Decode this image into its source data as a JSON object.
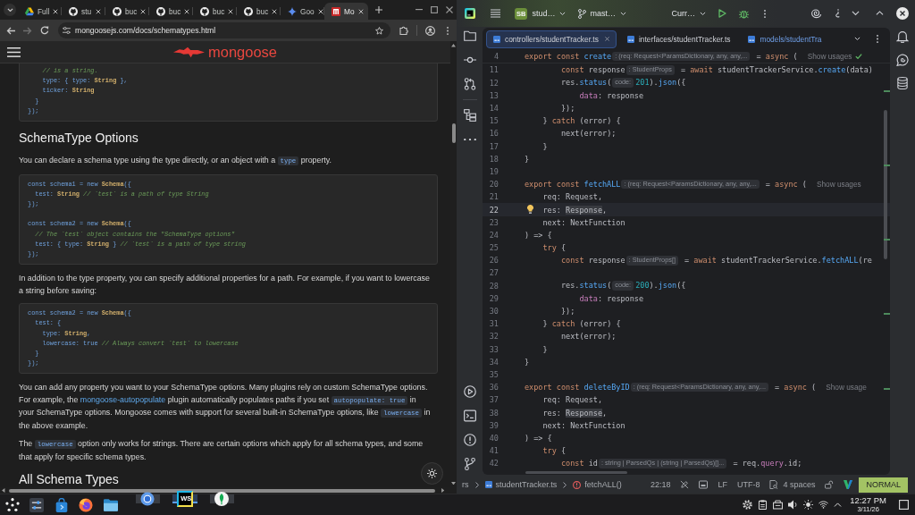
{
  "browser": {
    "tabs": [
      {
        "kind": "drive",
        "title": "Full",
        "selected": false
      },
      {
        "kind": "repo",
        "title": "stu",
        "selected": false
      },
      {
        "kind": "repo",
        "title": "buc",
        "selected": false
      },
      {
        "kind": "repo",
        "title": "buc",
        "selected": false
      },
      {
        "kind": "repo",
        "title": "buc",
        "selected": false
      },
      {
        "kind": "repo",
        "title": "buc",
        "selected": false
      },
      {
        "kind": "assistant",
        "title": "Goo",
        "selected": false
      },
      {
        "kind": "docs",
        "title": "Mo",
        "selected": true
      }
    ],
    "url": "mongoosejs.com/docs/schematypes.html",
    "site": {
      "logo_text": "mongoose"
    },
    "content": [
      {
        "kind": "code",
        "sections": [
          [
            [
              {
                "kind": "comment",
                "text": "    // is a string."
              }
            ],
            [
              {
                "kind": "plain",
                "text": "    type: { type: "
              },
              {
                "kind": "type",
                "text": "String"
              },
              {
                "kind": "plain",
                "text": " },"
              }
            ],
            [
              {
                "kind": "plain",
                "text": "    ticker: "
              },
              {
                "kind": "type",
                "text": "String"
              }
            ],
            [
              {
                "kind": "plain",
                "text": "  }"
              }
            ],
            [
              {
                "kind": "plain",
                "text": "});"
              }
            ]
          ]
        ]
      },
      {
        "kind": "heading",
        "text": "SchemaType Options"
      },
      {
        "kind": "paragraph",
        "parts": [
          {
            "kind": "text",
            "text": "You can declare a schema type using the type directly, or an object with a "
          },
          {
            "kind": "code",
            "text": "type"
          },
          {
            "kind": "text",
            "text": " property."
          }
        ]
      },
      {
        "kind": "code",
        "sections": [
          [
            [
              {
                "kind": "plain",
                "text": "const schema1 = new "
              },
              {
                "kind": "type",
                "text": "Schema"
              },
              {
                "kind": "plain",
                "text": "({"
              }
            ],
            [
              {
                "kind": "plain",
                "text": "  test: "
              },
              {
                "kind": "type",
                "text": "String"
              },
              {
                "kind": "comment",
                "text": " // `test` is a path of type String"
              }
            ],
            [
              {
                "kind": "plain",
                "text": "});"
              }
            ]
          ],
          [
            [
              {
                "kind": "plain",
                "text": "const schema2 = new "
              },
              {
                "kind": "type",
                "text": "Schema"
              },
              {
                "kind": "plain",
                "text": "({"
              }
            ],
            [
              {
                "kind": "comment",
                "text": "  // The `test` object contains the \"SchemaType options\""
              }
            ],
            [
              {
                "kind": "plain",
                "text": "  test: { type: "
              },
              {
                "kind": "type",
                "text": "String"
              },
              {
                "kind": "plain",
                "text": " } "
              },
              {
                "kind": "comment",
                "text": "// `test` is a path of type string"
              }
            ],
            [
              {
                "kind": "plain",
                "text": "});"
              }
            ]
          ]
        ]
      },
      {
        "kind": "paragraph",
        "parts": [
          {
            "kind": "text",
            "text": "In addition to the type property, you can specify additional properties for a path. For example, if you want to lowercase a string before saving:"
          }
        ]
      },
      {
        "kind": "code",
        "sections": [
          [
            [
              {
                "kind": "plain",
                "text": "const schema2 = new "
              },
              {
                "kind": "type",
                "text": "Schema"
              },
              {
                "kind": "plain",
                "text": "({"
              }
            ],
            [
              {
                "kind": "plain",
                "text": "  test: {"
              }
            ],
            [
              {
                "kind": "plain",
                "text": "    type: "
              },
              {
                "kind": "type",
                "text": "String"
              },
              {
                "kind": "plain",
                "text": ","
              }
            ],
            [
              {
                "kind": "plain",
                "text": "    lowercase: true "
              },
              {
                "kind": "comment",
                "text": "// Always convert `test` to lowercase"
              }
            ],
            [
              {
                "kind": "plain",
                "text": "  }"
              }
            ],
            [
              {
                "kind": "plain",
                "text": "});"
              }
            ]
          ]
        ]
      },
      {
        "kind": "paragraph",
        "parts": [
          {
            "kind": "text",
            "text": "You can add any property you want to your SchemaType options. Many plugins rely on custom SchemaType options. For example, the "
          },
          {
            "kind": "link",
            "text": "mongoose-autopopulate"
          },
          {
            "kind": "text",
            "text": " plugin automatically populates paths if you set "
          },
          {
            "kind": "code",
            "text": "autopopulate: true"
          },
          {
            "kind": "text",
            "text": " in your SchemaType options. Mongoose comes with support for several built-in SchemaType options, like "
          },
          {
            "kind": "code",
            "text": "lowercase"
          },
          {
            "kind": "text",
            "text": " in the above example."
          }
        ]
      },
      {
        "kind": "paragraph",
        "parts": [
          {
            "kind": "text",
            "text": "The "
          },
          {
            "kind": "code",
            "text": "lowercase"
          },
          {
            "kind": "text",
            "text": " option only works for strings. There are certain options which apply for all schema types, and some that apply for specific schema types."
          }
        ]
      },
      {
        "kind": "heading",
        "text": "All Schema Types"
      }
    ]
  },
  "ide": {
    "project": {
      "badge": "SB",
      "name": "stud…"
    },
    "branch": "mast…",
    "run_config": "Curr…",
    "tabs": [
      {
        "title": "controllers/studentTracker.ts",
        "selected": true,
        "modified": false
      },
      {
        "title": "interfaces/studentTracker.ts",
        "selected": false,
        "modified": false
      },
      {
        "title": "models/studentTra",
        "selected": false,
        "modified": true
      }
    ],
    "sticky_line": {
      "number": "4",
      "tokens": [
        {
          "kind": "keyword",
          "text": "export const "
        },
        {
          "kind": "function",
          "text": "create"
        },
        {
          "kind": "hint",
          "text": ": (req: Request<ParamsDictionary, any, any,..."
        },
        {
          "kind": "plain",
          "text": " = "
        },
        {
          "kind": "keyword",
          "text": "async"
        },
        {
          "kind": "plain",
          "text": " ("
        },
        {
          "kind": "usage",
          "text": "Show usages"
        },
        {
          "kind": "check"
        }
      ]
    },
    "lines": [
      {
        "number": "11",
        "current": false,
        "bulb": false,
        "tokens": [
          {
            "kind": "keyword",
            "text": "        const"
          },
          {
            "kind": "plain",
            "text": " response"
          },
          {
            "kind": "hint",
            "text": ": StudentProps"
          },
          {
            "kind": "plain",
            "text": " = "
          },
          {
            "kind": "keyword",
            "text": "await"
          },
          {
            "kind": "plain",
            "text": " studentTrackerService."
          },
          {
            "kind": "function",
            "text": "create"
          },
          {
            "kind": "plain",
            "text": "(data)"
          }
        ]
      },
      {
        "number": "12",
        "current": false,
        "bulb": false,
        "tokens": [
          {
            "kind": "plain",
            "text": "        res."
          },
          {
            "kind": "function",
            "text": "status"
          },
          {
            "kind": "plain",
            "text": "("
          },
          {
            "kind": "hint",
            "text": "code:"
          },
          {
            "kind": "number",
            "text": "201"
          },
          {
            "kind": "plain",
            "text": ")."
          },
          {
            "kind": "function",
            "text": "json"
          },
          {
            "kind": "plain",
            "text": "({"
          }
        ]
      },
      {
        "number": "13",
        "current": false,
        "bulb": false,
        "tokens": [
          {
            "kind": "property",
            "text": "            data"
          },
          {
            "kind": "plain",
            "text": ": response"
          }
        ]
      },
      {
        "number": "14",
        "current": false,
        "bulb": false,
        "tokens": [
          {
            "kind": "plain",
            "text": "        });"
          }
        ]
      },
      {
        "number": "15",
        "current": false,
        "bulb": false,
        "tokens": [
          {
            "kind": "plain",
            "text": "    } "
          },
          {
            "kind": "keyword",
            "text": "catch"
          },
          {
            "kind": "plain",
            "text": " (error) {"
          }
        ]
      },
      {
        "number": "16",
        "current": false,
        "bulb": false,
        "tokens": [
          {
            "kind": "plain",
            "text": "        next(error);"
          }
        ]
      },
      {
        "number": "17",
        "current": false,
        "bulb": false,
        "tokens": [
          {
            "kind": "plain",
            "text": "    }"
          }
        ]
      },
      {
        "number": "18",
        "current": false,
        "bulb": false,
        "tokens": [
          {
            "kind": "plain",
            "text": "}"
          }
        ]
      },
      {
        "number": "19",
        "current": false,
        "bulb": false
      },
      {
        "number": "20",
        "current": false,
        "bulb": false,
        "tokens": [
          {
            "kind": "keyword",
            "text": "export const "
          },
          {
            "kind": "function",
            "text": "fetchALL"
          },
          {
            "kind": "hint",
            "text": ": (req: Request<ParamsDictionary, any, any,..."
          },
          {
            "kind": "plain",
            "text": " = "
          },
          {
            "kind": "keyword",
            "text": "async"
          },
          {
            "kind": "plain",
            "text": " ("
          },
          {
            "kind": "usage",
            "text": "Show usages"
          }
        ]
      },
      {
        "number": "21",
        "current": false,
        "bulb": false,
        "tokens": [
          {
            "kind": "plain",
            "text": "    req: Request,"
          }
        ]
      },
      {
        "number": "22",
        "current": true,
        "bulb": true,
        "tokens": [
          {
            "kind": "plain",
            "text": "    res: "
          },
          {
            "kind": "highlight",
            "text": "Response"
          },
          {
            "kind": "plain",
            "text": ","
          }
        ]
      },
      {
        "number": "23",
        "current": false,
        "bulb": false,
        "tokens": [
          {
            "kind": "plain",
            "text": "    next: NextFunction"
          }
        ]
      },
      {
        "number": "24",
        "current": false,
        "bulb": false,
        "tokens": [
          {
            "kind": "plain",
            "text": ") => {"
          }
        ]
      },
      {
        "number": "25",
        "current": false,
        "bulb": false,
        "tokens": [
          {
            "kind": "keyword",
            "text": "    try"
          },
          {
            "kind": "plain",
            "text": " {"
          }
        ]
      },
      {
        "number": "26",
        "current": false,
        "bulb": false,
        "tokens": [
          {
            "kind": "keyword",
            "text": "        const"
          },
          {
            "kind": "plain",
            "text": " response"
          },
          {
            "kind": "hint",
            "text": ": StudentProps[]"
          },
          {
            "kind": "plain",
            "text": " = "
          },
          {
            "kind": "keyword",
            "text": "await"
          },
          {
            "kind": "plain",
            "text": " studentTrackerService."
          },
          {
            "kind": "function",
            "text": "fetchALL"
          },
          {
            "kind": "plain",
            "text": "(re"
          }
        ]
      },
      {
        "number": "27",
        "current": false,
        "bulb": false
      },
      {
        "number": "28",
        "current": false,
        "bulb": false,
        "tokens": [
          {
            "kind": "plain",
            "text": "        res."
          },
          {
            "kind": "function",
            "text": "status"
          },
          {
            "kind": "plain",
            "text": "("
          },
          {
            "kind": "hint",
            "text": "code:"
          },
          {
            "kind": "number",
            "text": "200"
          },
          {
            "kind": "plain",
            "text": ")."
          },
          {
            "kind": "function",
            "text": "json"
          },
          {
            "kind": "plain",
            "text": "({"
          }
        ]
      },
      {
        "number": "29",
        "current": false,
        "bulb": false,
        "tokens": [
          {
            "kind": "property",
            "text": "            data"
          },
          {
            "kind": "plain",
            "text": ": response"
          }
        ]
      },
      {
        "number": "30",
        "current": false,
        "bulb": false,
        "tokens": [
          {
            "kind": "plain",
            "text": "        });"
          }
        ]
      },
      {
        "number": "31",
        "current": false,
        "bulb": false,
        "tokens": [
          {
            "kind": "plain",
            "text": "    } "
          },
          {
            "kind": "keyword",
            "text": "catch"
          },
          {
            "kind": "plain",
            "text": " (error) {"
          }
        ]
      },
      {
        "number": "32",
        "current": false,
        "bulb": false,
        "tokens": [
          {
            "kind": "plain",
            "text": "        next(error);"
          }
        ]
      },
      {
        "number": "33",
        "current": false,
        "bulb": false,
        "tokens": [
          {
            "kind": "plain",
            "text": "    }"
          }
        ]
      },
      {
        "number": "34",
        "current": false,
        "bulb": false,
        "tokens": [
          {
            "kind": "plain",
            "text": "}"
          }
        ]
      },
      {
        "number": "35",
        "current": false,
        "bulb": false
      },
      {
        "number": "36",
        "current": false,
        "bulb": false,
        "tokens": [
          {
            "kind": "keyword",
            "text": "export const "
          },
          {
            "kind": "function",
            "text": "deleteByID"
          },
          {
            "kind": "hint",
            "text": ": (req: Request<ParamsDictionary, any, any,..."
          },
          {
            "kind": "plain",
            "text": " = "
          },
          {
            "kind": "keyword",
            "text": "async"
          },
          {
            "kind": "plain",
            "text": " ("
          },
          {
            "kind": "usage",
            "text": "Show usage"
          }
        ]
      },
      {
        "number": "37",
        "current": false,
        "bulb": false,
        "tokens": [
          {
            "kind": "plain",
            "text": "    req: Request,"
          }
        ]
      },
      {
        "number": "38",
        "current": false,
        "bulb": false,
        "tokens": [
          {
            "kind": "plain",
            "text": "    res: "
          },
          {
            "kind": "highlight",
            "text": "Response"
          },
          {
            "kind": "plain",
            "text": ","
          }
        ]
      },
      {
        "number": "39",
        "current": false,
        "bulb": false,
        "tokens": [
          {
            "kind": "plain",
            "text": "    next: NextFunction"
          }
        ]
      },
      {
        "number": "40",
        "current": false,
        "bulb": false,
        "tokens": [
          {
            "kind": "plain",
            "text": ") => {"
          }
        ]
      },
      {
        "number": "41",
        "current": false,
        "bulb": false,
        "tokens": [
          {
            "kind": "keyword",
            "text": "    try"
          },
          {
            "kind": "plain",
            "text": " {"
          }
        ]
      },
      {
        "number": "42",
        "current": false,
        "bulb": false,
        "tokens": [
          {
            "kind": "keyword",
            "text": "        const"
          },
          {
            "kind": "plain",
            "text": " id"
          },
          {
            "kind": "hint",
            "text": ": string | ParsedQs | (string | ParsedQs)[]..."
          },
          {
            "kind": "plain",
            "text": " = req."
          },
          {
            "kind": "property",
            "text": "query"
          },
          {
            "kind": "plain",
            "text": ".id;"
          }
        ]
      }
    ],
    "status": {
      "breadcrumbs": [
        {
          "kind": "folder",
          "text": "rs"
        },
        {
          "kind": "file",
          "text": "studentTracker.ts"
        },
        {
          "kind": "function",
          "text": "fetchALL()"
        }
      ],
      "position": "22:18",
      "line_separator": "LF",
      "encoding": "UTF-8",
      "indent": "4 spaces",
      "vim_mode": "NORMAL"
    }
  },
  "taskbar": {
    "apps": [
      {
        "kind": "launcher",
        "running": false,
        "selected": false
      },
      {
        "kind": "settings",
        "running": false,
        "selected": false
      },
      {
        "kind": "store",
        "running": false,
        "selected": false
      },
      {
        "kind": "firefox",
        "running": false,
        "selected": false
      },
      {
        "kind": "files",
        "running": false,
        "selected": false
      },
      {
        "kind": "chromium",
        "running": true,
        "selected": false
      },
      {
        "kind": "ide",
        "label": "WS",
        "running": true,
        "selected": true
      },
      {
        "kind": "database",
        "running": true,
        "selected": false
      }
    ],
    "clock": {
      "time": "12:27 PM",
      "date": "3/11/26"
    }
  }
}
